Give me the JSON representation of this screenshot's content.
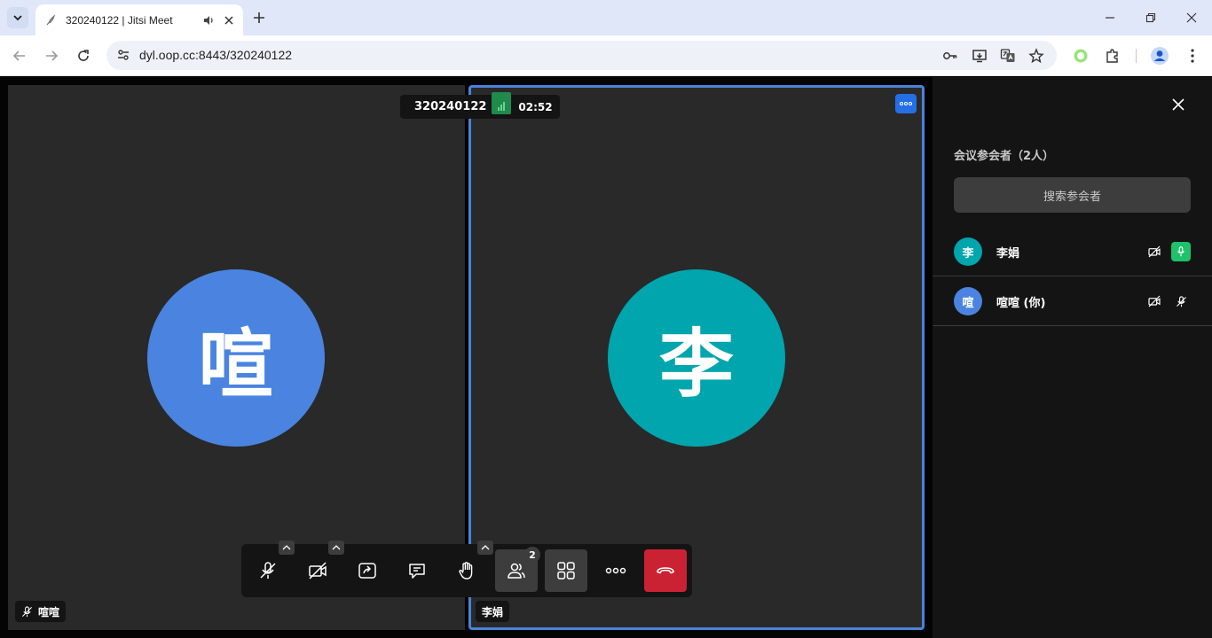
{
  "browser": {
    "tab_title": "320240122 | Jitsi Meet",
    "url": "dyl.oop.cc:8443/320240122"
  },
  "meeting": {
    "room_name": "320240122",
    "timer": "02:52"
  },
  "tiles": {
    "left": {
      "avatar_initial": "喧",
      "name": "喧喧",
      "avatar_color": "#4a84e0"
    },
    "right": {
      "avatar_initial": "李",
      "name": "李娟",
      "avatar_color": "#00a5ad"
    }
  },
  "toolbar": {
    "participants_count": "2"
  },
  "panel": {
    "heading": "会议参会者（2人）",
    "search_placeholder": "搜索参会者",
    "participants": [
      {
        "initial": "李",
        "name": "李娟",
        "avatar_color": "#00a5ad",
        "mic": "on"
      },
      {
        "initial": "喧",
        "name": "喧喧 (你)",
        "avatar_color": "#4a84e0",
        "mic": "muted"
      }
    ]
  },
  "colors": {
    "tab_strip": "#dfe7f8",
    "active_tile_border": "#4a83d8",
    "hangup": "#cb2233",
    "mic_on": "#1ec26a"
  }
}
